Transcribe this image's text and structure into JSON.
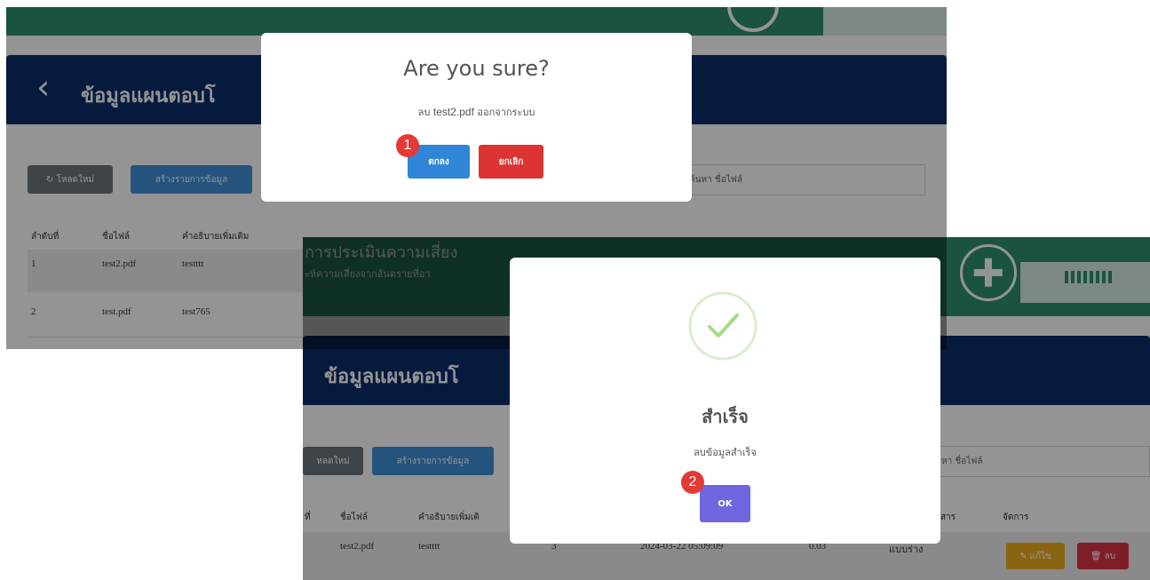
{
  "panel1": {
    "header_title": "ข้อมูลแผนตอบโ",
    "buttons": {
      "reload": "↻ โหลดใหม่",
      "create": "สร้างรายการข้อมูล"
    },
    "search_placeholder": "ค้นหา ชื่อไฟล์",
    "table": {
      "headers": [
        "ลำดับที่",
        "ชื่อไฟล์",
        "คำอธิบายเพิ่มเติม"
      ],
      "rows": [
        [
          "1",
          "test2.pdf",
          "testttt"
        ],
        [
          "2",
          "test.pdf",
          "test765"
        ]
      ]
    },
    "modal": {
      "title": "Are you sure?",
      "message_prefix": "ลบ",
      "file_name": "test2.pdf",
      "message_suffix": "ออกจากระบบ",
      "confirm": "ตกลง",
      "cancel": "ยกเลิก",
      "step": "1"
    }
  },
  "panel2": {
    "banner_title": "การประเมินความเสี่ยง",
    "banner_subtitle": "ะห์ความเสี่ยงจากอันตรายที่อา",
    "header_title": "ข้อมูลแผนตอบโ",
    "buttons": {
      "reload": "หลดใหม่",
      "create": "สร้างรายการข้อมูล"
    },
    "search_placeholder": "หา ชื่อไฟล์",
    "table": {
      "headers": [
        "ที่",
        "ชื่อไฟล์",
        "คำอธิบายเพิ่มเติ",
        "สาร",
        "จัดการ"
      ],
      "row": {
        "file": "test2.pdf",
        "desc": "testttt",
        "num": "3",
        "date": "2024-03-22 05:09:09",
        "size": "0.03",
        "type": "แบบร่าง",
        "edit": "แก้ไข",
        "delete": "ลบ"
      }
    },
    "modal": {
      "title": "สำเร็จ",
      "message": "ลบข้อมูลสำเร็จ",
      "ok": "OK",
      "step": "2"
    }
  },
  "colors": {
    "banner": "#2e8f70",
    "header": "#0b2e6b",
    "confirm": "#3085d6",
    "cancel": "#dd3333",
    "ok": "#7066e0",
    "badge": "#e53935",
    "success": "#a5dc86"
  }
}
